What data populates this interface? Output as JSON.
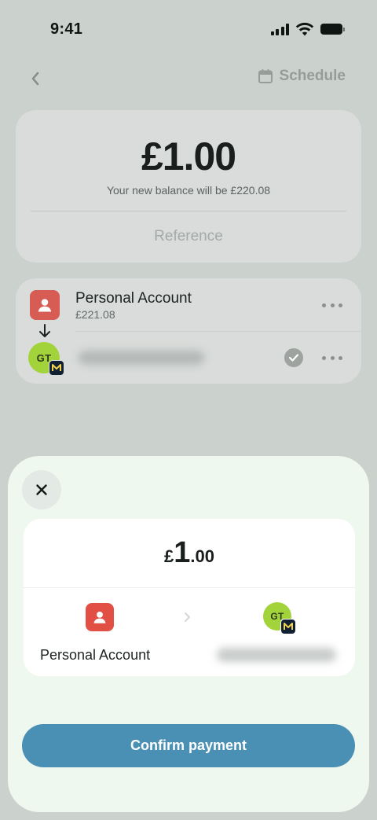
{
  "status_bar": {
    "time": "9:41"
  },
  "nav": {
    "schedule_label": "Schedule"
  },
  "amount_card": {
    "amount": "£1.00",
    "balance_note": "Your new balance will be £220.08",
    "reference_placeholder": "Reference"
  },
  "accounts": {
    "from": {
      "name": "Personal Account",
      "balance": "£221.08"
    },
    "to": {
      "initials": "GT"
    }
  },
  "sheet": {
    "amount": {
      "currency": "£",
      "whole": "1",
      "decimals": ".00"
    },
    "from_label": "Personal Account",
    "to_initials": "GT",
    "confirm_label": "Confirm payment"
  },
  "colors": {
    "accent": "#4a8fb4",
    "personal_account": "#e24f45",
    "recipient_avatar": "#a3d33a",
    "sheet_background": "#eff8ef"
  },
  "icons": [
    "back-chevron-icon",
    "calendar-icon",
    "person-icon",
    "arrow-down-icon",
    "check-icon",
    "more-icon",
    "close-icon",
    "chevron-right-icon",
    "monzo-icon"
  ]
}
